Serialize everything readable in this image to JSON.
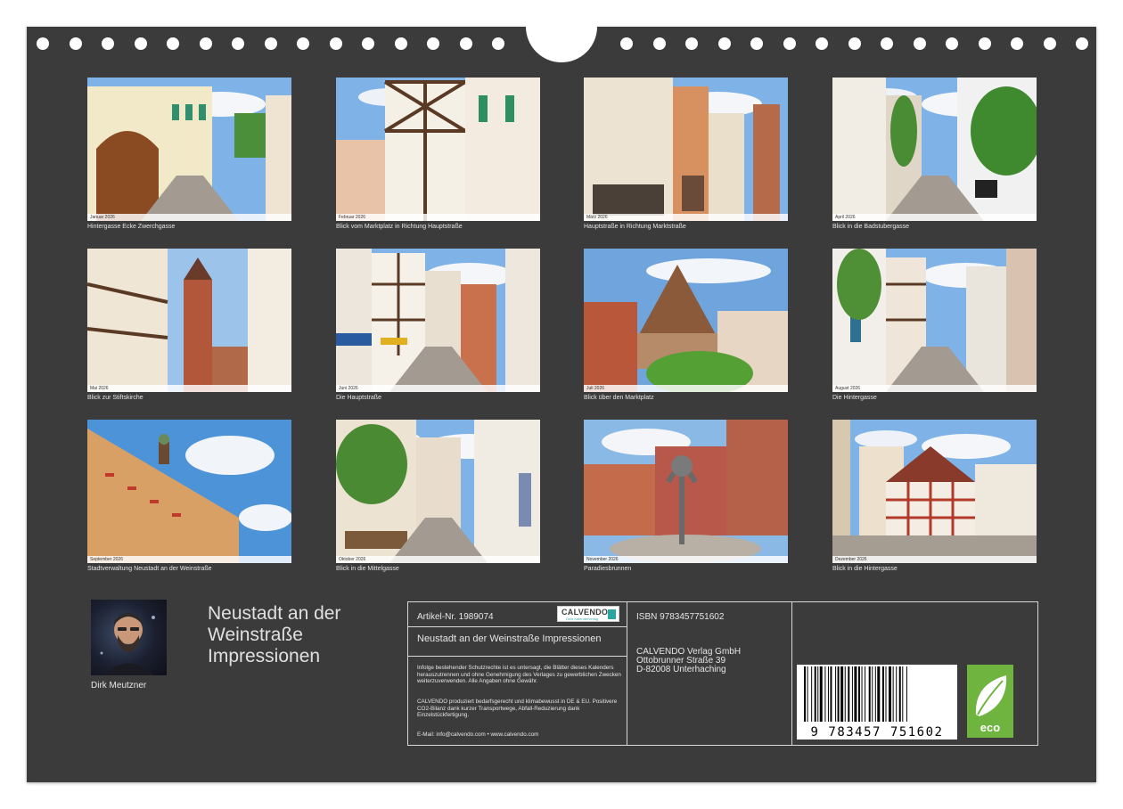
{
  "calendar": {
    "title_lines": [
      "Neustadt an der",
      "Weinstraße",
      "Impressionen"
    ],
    "author": "Dirk Meutzner",
    "photos": [
      {
        "caption": "Hintergasse Ecke Zwerchgasse",
        "month": "Januar 2026",
        "scene": "street-arch"
      },
      {
        "caption": "Blick vom Marktplatz in Richtung Hauptstraße",
        "month": "Februar 2026",
        "scene": "half-timber-corner"
      },
      {
        "caption": "Hauptstraße in Richtung Marktstraße",
        "month": "März 2026",
        "scene": "shopping-street"
      },
      {
        "caption": "Blick in die Badstubergasse",
        "month": "April 2026",
        "scene": "green-alley"
      },
      {
        "caption": "Blick zur Stiftskirche",
        "month": "Mai 2026",
        "scene": "church-tower"
      },
      {
        "caption": "Die Hauptstraße",
        "month": "Juni 2026",
        "scene": "busy-street"
      },
      {
        "caption": "Blick über den Marktplatz",
        "month": "Juli 2026",
        "scene": "market-house"
      },
      {
        "caption": "Die Hintergasse",
        "month": "August 2026",
        "scene": "narrow-lane"
      },
      {
        "caption": "Stadtverwaltung Neustadt an der Weinstraße",
        "month": "September 2026",
        "scene": "town-hall"
      },
      {
        "caption": "Blick in die Mittelgasse",
        "month": "Oktober 2026",
        "scene": "ivy-lane"
      },
      {
        "caption": "Paradiesbrunnen",
        "month": "November 2026",
        "scene": "fountain"
      },
      {
        "caption": "Blick in die Hintergasse",
        "month": "Dezember 2026",
        "scene": "red-timber-house"
      }
    ]
  },
  "info": {
    "article": "Artikel-Nr. 1989074",
    "brand": "CALVENDO",
    "brand_sub": "Dein Kalenderverlag",
    "product_title": "Neustadt an der Weinstraße Impressionen",
    "legal": "Infolge bestehender Schutzrechte ist es untersagt, die Blätter dieses Kalenders herauszutrennen und ohne Genehmigung des Verlages zu gewerblichen Zwecken weiterzuverwenden. Alle Angaben ohne Gewähr.",
    "climate": "CALVENDO produziert bedarfsgerecht und klimabewusst in DE & EU. Positivere CO2-Bilanz dank kurzer Transportwege, Abfall-Reduzierung dank Einzelstückfertigung.",
    "contact": "E-Mail: info@calvendo.com • www.calvendo.com",
    "isbn": "ISBN 9783457751602",
    "publisher_lines": [
      "CALVENDO Verlag GmbH",
      "Ottobrunner Straße 39",
      "D-82008 Unterhaching"
    ],
    "barcode_number": "9 783457 751602",
    "eco_label": "eco"
  },
  "colors": {
    "background": "#3b3b3b",
    "text": "#e6e6e6",
    "eco_green": "#6fb43f",
    "brand_teal": "#2aa6a0"
  }
}
